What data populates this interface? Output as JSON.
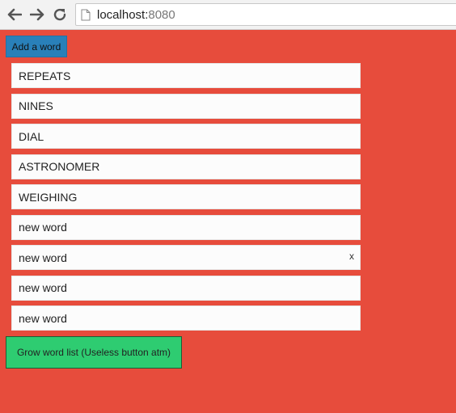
{
  "browser": {
    "url_host": "localhost:",
    "url_port": "8080",
    "icons": {
      "back": "arrow-left-icon",
      "forward": "arrow-right-icon",
      "reload": "reload-icon",
      "page": "page-icon"
    }
  },
  "page": {
    "background_color": "#e74c3c",
    "add_word_label": "Add a word",
    "add_word_color": "#2980b9",
    "words": [
      {
        "text": "REPEATS",
        "show_remove": false
      },
      {
        "text": "NINES",
        "show_remove": false
      },
      {
        "text": "DIAL",
        "show_remove": false
      },
      {
        "text": "ASTRONOMER",
        "show_remove": false
      },
      {
        "text": "WEIGHING",
        "show_remove": false
      },
      {
        "text": "new word",
        "show_remove": false
      },
      {
        "text": "new word",
        "show_remove": true
      },
      {
        "text": "new word",
        "show_remove": false
      },
      {
        "text": "new word",
        "show_remove": false
      }
    ],
    "remove_label": "x",
    "grow_label": "Grow word list (Useless button atm)",
    "grow_color": "#2ecc71"
  }
}
